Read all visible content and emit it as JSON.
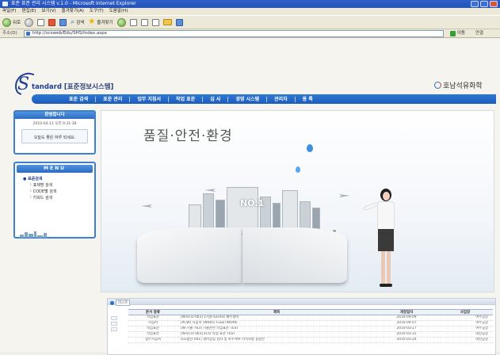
{
  "window": {
    "title": "표준 표준 관리 시스템 v.1.0 - Microsoft Internet Explorer"
  },
  "menubar": [
    "파일(F)",
    "편집(E)",
    "보기(V)",
    "즐겨찾기(A)",
    "도구(T)",
    "도움말(H)"
  ],
  "toolbar": {
    "back_label": "뒤로",
    "search_label": "검색",
    "favorites_label": "즐겨찾기"
  },
  "addressbar": {
    "label": "주소(D)",
    "url": "http://scsweb/Edu/SHS/Index.aspx",
    "go_label": "이동",
    "links_label": "연결"
  },
  "logo": {
    "s_letter": "S",
    "text_en": "tandard",
    "text_ko": "[표준정보시스템]"
  },
  "company": "호남석유화학",
  "nav": [
    "표준 검색",
    "표준 관리",
    "업무 지침서",
    "작업 표준",
    "심 사",
    "경영 시스템",
    "관리자",
    "용 록"
  ],
  "welcome": {
    "heading": "환영합니다",
    "date": "2010-04-11 오전 9:31:38",
    "message": "오늘도 좋은 하루 되세요."
  },
  "menu": {
    "heading": "MENU",
    "root": "표준검색",
    "items": [
      "표제명 검색",
      "CODE별 검색",
      "키워드 검색"
    ]
  },
  "hero": {
    "title": "품질·안전·환경",
    "badge": "NO.1"
  },
  "list": {
    "tab_label": "리스트",
    "columns": [
      "문서 종류",
      "제목",
      "개정일자",
      "사업장"
    ],
    "rows": [
      [
        "작업표준",
        "[W-ECO-003] 1지원 Excess 폐수설비",
        "2010-04-09",
        "여수공장"
      ],
      [
        "지침서",
        "[PCW] 지침서 (W005) FLEETWORK",
        "2010-04-07",
        "여수공장"
      ],
      [
        "작업표준",
        "[W-기술-763] 기술관련 작업표준 TEST",
        "2010-03-27",
        "여수공장"
      ],
      [
        "작업표준",
        "[W-ECO-003] ECO 작업 표준 TEST",
        "2010-03-31",
        "대산공장"
      ],
      [
        "업무지침서",
        "[LG생산-001] 설비업업 검사 및 보수계획 지적사항 통합본",
        "2010-03-24",
        "대산공장"
      ]
    ]
  },
  "colors": {
    "nav_blue": "#1c5cb8",
    "panel_border": "#3c7fd0",
    "logo_navy": "#1f3f8e"
  }
}
